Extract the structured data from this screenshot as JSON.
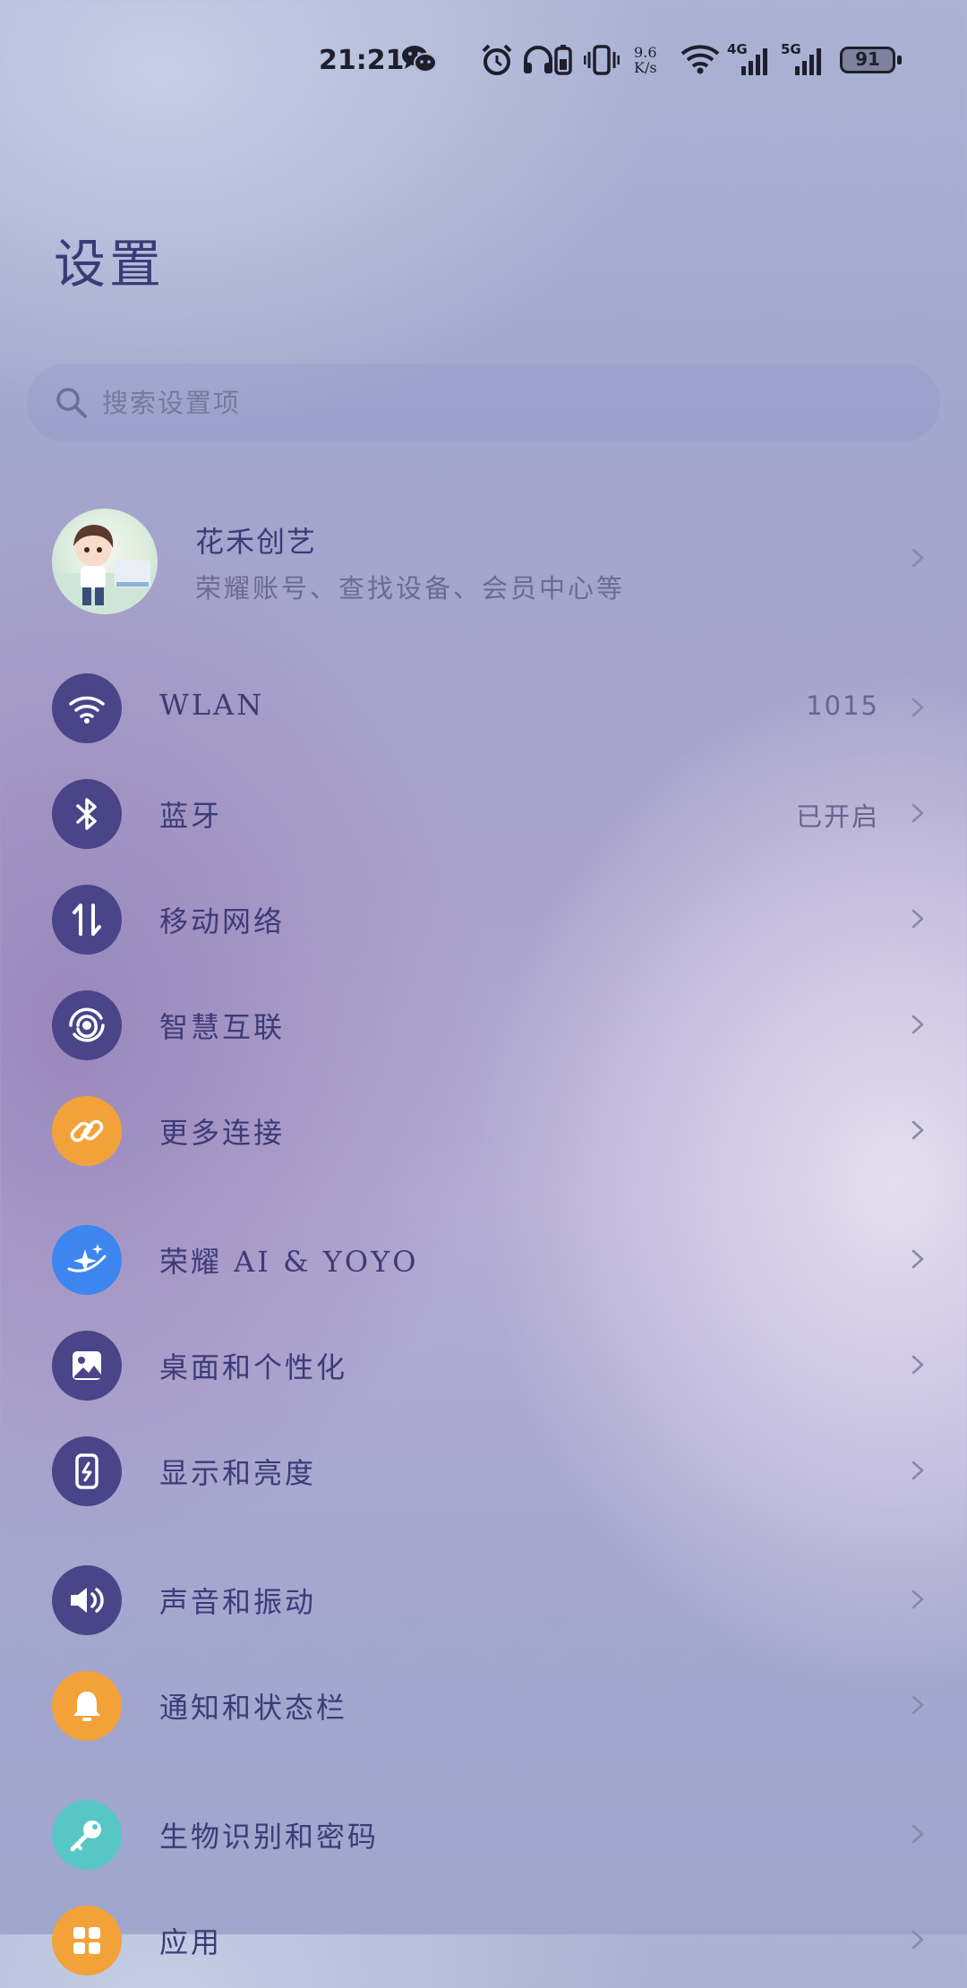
{
  "status_bar": {
    "time": "21:21",
    "net_speed_value": "9.6",
    "net_speed_unit": "K/s",
    "network_4g": "4G",
    "network_5g": "5G",
    "battery": "91",
    "icons": [
      "wechat-icon",
      "alarm-icon",
      "headphones-icon",
      "battery-device-icon",
      "vibrate-icon",
      "wifi-icon",
      "signal-4g-icon",
      "signal-5g-icon",
      "battery-icon"
    ]
  },
  "page": {
    "title": "设置"
  },
  "search": {
    "placeholder": "搜索设置项"
  },
  "account": {
    "name": "花禾创艺",
    "subtitle": "荣耀账号、查找设备、会员中心等"
  },
  "menu": {
    "items": [
      {
        "label": "WLAN",
        "value": "1015",
        "icon": "wifi-icon",
        "color": "#4a4488"
      },
      {
        "label": "蓝牙",
        "value": "已开启",
        "icon": "bluetooth-icon",
        "color": "#4a4488"
      },
      {
        "label": "移动网络",
        "value": "",
        "icon": "mobile-data-icon",
        "color": "#4a4488"
      },
      {
        "label": "智慧互联",
        "value": "",
        "icon": "smart-connect-icon",
        "color": "#4a4488"
      },
      {
        "label": "更多连接",
        "value": "",
        "icon": "link-icon",
        "color": "#f3a23a"
      },
      {
        "label": "荣耀 AI & YOYO",
        "value": "",
        "icon": "ai-sparkle-icon",
        "color": "#3d86f0"
      },
      {
        "label": "桌面和个性化",
        "value": "",
        "icon": "image-icon",
        "color": "#4a4488"
      },
      {
        "label": "显示和亮度",
        "value": "",
        "icon": "display-icon",
        "color": "#4a4488"
      },
      {
        "label": "声音和振动",
        "value": "",
        "icon": "speaker-icon",
        "color": "#4a4488"
      },
      {
        "label": "通知和状态栏",
        "value": "",
        "icon": "bell-icon",
        "color": "#f3a23a"
      },
      {
        "label": "生物识别和密码",
        "value": "",
        "icon": "key-icon",
        "color": "#56c7c4"
      },
      {
        "label": "应用",
        "value": "",
        "icon": "apps-icon",
        "color": "#f3a23a"
      }
    ]
  }
}
